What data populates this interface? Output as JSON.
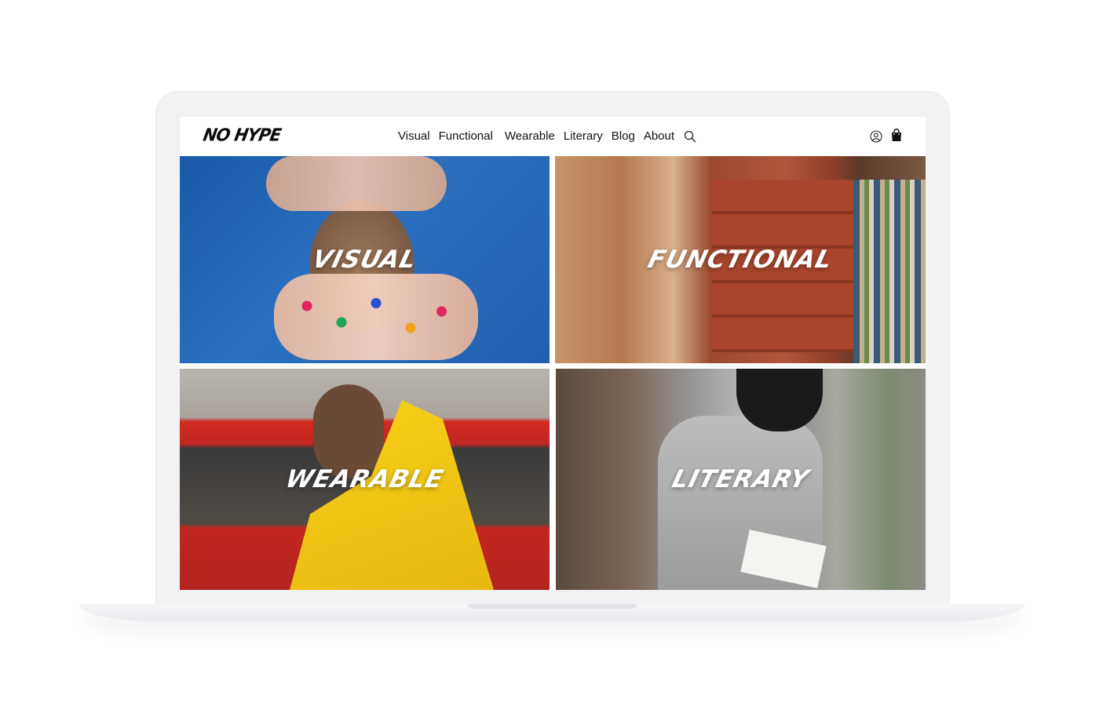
{
  "brand": {
    "logo": "NO HYPE"
  },
  "nav": {
    "links": [
      "Visual",
      "Functional",
      "Wearable",
      "Literary",
      "Blog",
      "About"
    ],
    "icons": {
      "search": "search-icon",
      "account": "user-icon",
      "cart": "bag-icon"
    }
  },
  "tiles": [
    {
      "label": "Visual"
    },
    {
      "label": "Functional"
    },
    {
      "label": "Wearable"
    },
    {
      "label": "Literary"
    }
  ],
  "colors": {
    "text": "#111111",
    "label": "#ffffff",
    "frame": "#f2f2f4"
  }
}
